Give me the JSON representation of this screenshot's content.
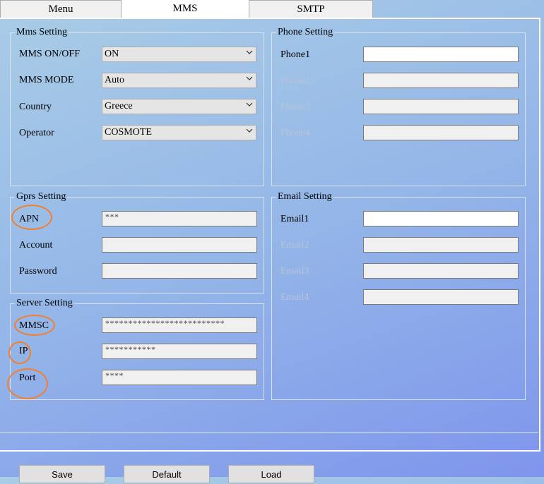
{
  "tabs": [
    {
      "label": "Menu"
    },
    {
      "label": "MMS"
    },
    {
      "label": "SMTP"
    }
  ],
  "mms_setting": {
    "title": "Mms Setting",
    "rows": [
      {
        "label": "MMS ON/OFF",
        "value": "ON"
      },
      {
        "label": "MMS MODE",
        "value": "Auto"
      },
      {
        "label": "Country",
        "value": "Greece"
      },
      {
        "label": "Operator",
        "value": "COSMOTE"
      }
    ]
  },
  "phone_setting": {
    "title": "Phone Setting",
    "rows": [
      {
        "label": "Phone1",
        "value": ""
      },
      {
        "label": "Phone2",
        "value": ""
      },
      {
        "label": "Phone3",
        "value": ""
      },
      {
        "label": "Phone4",
        "value": ""
      }
    ]
  },
  "gprs_setting": {
    "title": "Gprs Setting",
    "rows": [
      {
        "label": "APN",
        "value": "***"
      },
      {
        "label": "Account",
        "value": ""
      },
      {
        "label": "Password",
        "value": ""
      }
    ]
  },
  "server_setting": {
    "title": "Server Setting",
    "rows": [
      {
        "label": "MMSC",
        "value": "**************************"
      },
      {
        "label": "IP",
        "value": "***********"
      },
      {
        "label": "Port",
        "value": "****"
      }
    ]
  },
  "email_setting": {
    "title": "Email Setting",
    "rows": [
      {
        "label": "Email1",
        "value": ""
      },
      {
        "label": "Email2",
        "value": ""
      },
      {
        "label": "Email3",
        "value": ""
      },
      {
        "label": "Email4",
        "value": ""
      }
    ]
  },
  "buttons": {
    "save": "Save",
    "default": "Default",
    "load": "Load"
  },
  "annotation_color": "#f08030"
}
